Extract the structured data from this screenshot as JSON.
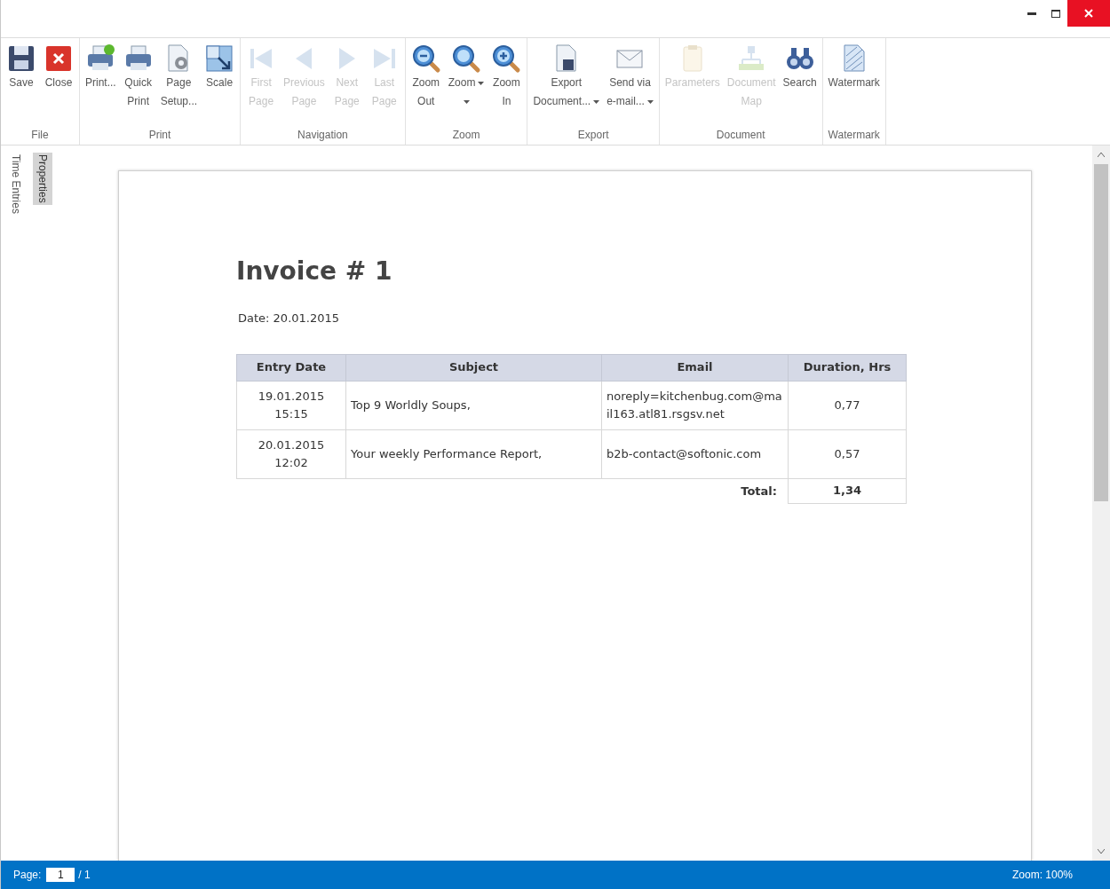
{
  "ribbon": {
    "groups": [
      {
        "title": "File",
        "buttons": [
          {
            "kind": "save",
            "lines": [
              "Save"
            ],
            "disabled": false,
            "dropdown": false
          },
          {
            "kind": "close",
            "lines": [
              "Close"
            ],
            "disabled": false,
            "dropdown": false
          }
        ]
      },
      {
        "title": "Print",
        "buttons": [
          {
            "kind": "print",
            "lines": [
              "Print..."
            ],
            "disabled": false,
            "dropdown": false
          },
          {
            "kind": "quickprint",
            "lines": [
              "Quick",
              "Print"
            ],
            "disabled": false,
            "dropdown": false
          },
          {
            "kind": "pagesetup",
            "lines": [
              "Page",
              "Setup..."
            ],
            "disabled": false,
            "dropdown": false
          },
          {
            "kind": "scale",
            "lines": [
              "Scale"
            ],
            "disabled": false,
            "dropdown": false
          }
        ]
      },
      {
        "title": "Navigation",
        "buttons": [
          {
            "kind": "first",
            "lines": [
              "First",
              "Page"
            ],
            "disabled": true,
            "dropdown": false
          },
          {
            "kind": "prev",
            "lines": [
              "Previous",
              "Page"
            ],
            "disabled": true,
            "dropdown": false
          },
          {
            "kind": "next",
            "lines": [
              "Next",
              "Page"
            ],
            "disabled": true,
            "dropdown": false
          },
          {
            "kind": "last",
            "lines": [
              "Last",
              "Page"
            ],
            "disabled": true,
            "dropdown": false
          }
        ]
      },
      {
        "title": "Zoom",
        "buttons": [
          {
            "kind": "zoomout",
            "lines": [
              "Zoom",
              "Out"
            ],
            "disabled": false,
            "dropdown": false
          },
          {
            "kind": "zoom",
            "lines": [
              "Zoom"
            ],
            "disabled": false,
            "dropdown": true
          },
          {
            "kind": "zoomin",
            "lines": [
              "Zoom",
              "In"
            ],
            "disabled": false,
            "dropdown": false
          }
        ]
      },
      {
        "title": "Export",
        "buttons": [
          {
            "kind": "export",
            "lines": [
              "Export",
              "Document..."
            ],
            "disabled": false,
            "dropdown": true
          },
          {
            "kind": "email",
            "lines": [
              "Send via",
              "e-mail..."
            ],
            "disabled": false,
            "dropdown": true
          }
        ]
      },
      {
        "title": "Document",
        "buttons": [
          {
            "kind": "parameters",
            "lines": [
              "Parameters"
            ],
            "disabled": true,
            "dropdown": false
          },
          {
            "kind": "docmap",
            "lines": [
              "Document",
              "Map"
            ],
            "disabled": true,
            "dropdown": false
          },
          {
            "kind": "search",
            "lines": [
              "Search"
            ],
            "disabled": false,
            "dropdown": false
          }
        ]
      },
      {
        "title": "Watermark",
        "buttons": [
          {
            "kind": "watermark",
            "lines": [
              "Watermark"
            ],
            "disabled": false,
            "dropdown": false
          }
        ]
      }
    ]
  },
  "side_tabs": [
    {
      "label": "Time Entries",
      "selected": false
    },
    {
      "label": "Properties",
      "selected": true
    }
  ],
  "document": {
    "title": "Invoice # 1",
    "date": "Date: 20.01.2015",
    "table": {
      "columns": [
        "Entry Date",
        "Subject",
        "Email",
        "Duration, Hrs"
      ],
      "rows": [
        [
          "19.01.2015 15:15",
          "Top 9 Worldly Soups,",
          "noreply=kitchenbug.com@mail163.atl81.rsgsv.net",
          "0,77"
        ],
        [
          "20.01.2015 12:02",
          "Your weekly Performance Report,",
          "b2b-contact@softonic.com",
          "0,57"
        ]
      ],
      "total_label": "Total:",
      "total_value": "1,34"
    }
  },
  "status_bar": {
    "page_label": "Page:",
    "page_value": "1",
    "page_count": "/ 1",
    "zoom": "Zoom: 100%"
  }
}
